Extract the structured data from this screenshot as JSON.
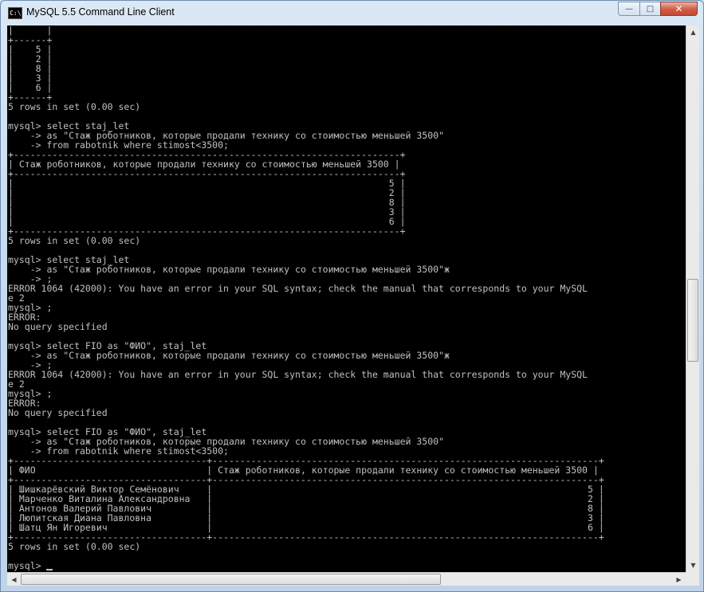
{
  "window": {
    "title": "MySQL 5.5 Command Line Client",
    "icon_text": "C:\\",
    "min_label": "—",
    "max_label": "□",
    "close_label": "✕"
  },
  "console": {
    "lines": [
      "|      |",
      "+------+",
      "|    5 |",
      "|    2 |",
      "|    8 |",
      "|    3 |",
      "|    6 |",
      "+------+",
      "5 rows in set (0.00 sec)",
      "",
      "mysql> select staj_let",
      "    -> as \"Стаж роботников, которые продали технику со стоимостью меньшей 3500\"",
      "    -> from rabotnik where stimost<3500;",
      "+----------------------------------------------------------------------+",
      "| Стаж роботников, которые продали технику со стоимостью меньшей 3500 |",
      "+----------------------------------------------------------------------+",
      "|                                                                    5 |",
      "|                                                                    2 |",
      "|                                                                    8 |",
      "|                                                                    3 |",
      "|                                                                    6 |",
      "+----------------------------------------------------------------------+",
      "5 rows in set (0.00 sec)",
      "",
      "mysql> select staj_let",
      "    -> as \"Стаж роботников, которые продали технику со стоимостью меньшей 3500\"ж",
      "    -> ;",
      "ERROR 1064 (42000): You have an error in your SQL syntax; check the manual that corresponds to your MySQL",
      "e 2",
      "mysql> ;",
      "ERROR:",
      "No query specified",
      "",
      "mysql> select FIO as \"ФИО\", staj_let",
      "    -> as \"Стаж роботников, которые продали технику со стоимостью меньшей 3500\"ж",
      "    -> ;",
      "ERROR 1064 (42000): You have an error in your SQL syntax; check the manual that corresponds to your MySQL",
      "e 2",
      "mysql> ;",
      "ERROR:",
      "No query specified",
      "",
      "mysql> select FIO as \"ФИО\", staj_let",
      "    -> as \"Стаж роботников, которые продали технику со стоимостью меньшей 3500\"",
      "    -> from rabotnik where stimost<3500;",
      "+-----------------------------------+----------------------------------------------------------------------+",
      "| ФИО                               | Стаж роботников, которые продали технику со стоимостью меньшей 3500 |",
      "+-----------------------------------+----------------------------------------------------------------------+",
      "| Шишкарёвский Виктор Семёнович     |                                                                    5 |",
      "| Марченко Виталина Александровна   |                                                                    2 |",
      "| Антонов Валерий Павлович          |                                                                    8 |",
      "| Люпитская Диана Павловна          |                                                                    3 |",
      "| Шатц Ян Игоревич                  |                                                                    6 |",
      "+-----------------------------------+----------------------------------------------------------------------+",
      "5 rows in set (0.00 sec)",
      "",
      "mysql> "
    ]
  },
  "scrollbars": {
    "up_arrow": "▲",
    "down_arrow": "▼",
    "left_arrow": "◀",
    "right_arrow": "▶"
  }
}
